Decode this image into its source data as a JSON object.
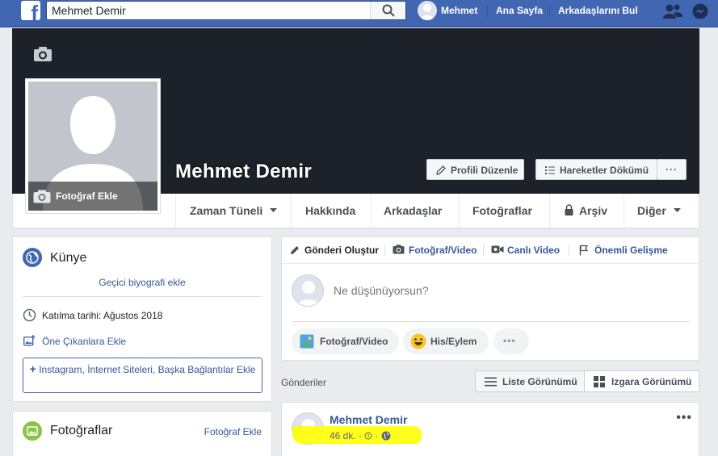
{
  "topbar": {
    "search_value": "Mehmet Demir",
    "user_name": "Mehmet",
    "home_label": "Ana Sayfa",
    "find_friends_label": "Arkadaşlarını Bul",
    "logo_glyph": "f",
    "colors": {
      "bar": "#4267b2",
      "accent": "#365899"
    }
  },
  "cover": {
    "name": "Mehmet Demir",
    "add_photo_label": "Fotoğraf Ekle",
    "edit_profile_label": "Profili Düzenle",
    "activity_log_label": "Hareketler Dökümü",
    "more_glyph": "···"
  },
  "tabs": [
    {
      "label": "Zaman Tüneli"
    },
    {
      "label": "Hakkında"
    },
    {
      "label": "Arkadaşlar"
    },
    {
      "label": "Fotoğraflar"
    },
    {
      "label": "Arşiv"
    },
    {
      "label": "Diğer"
    }
  ],
  "intro": {
    "title": "Künye",
    "temp_bio_link": "Geçici biyografi ekle",
    "join_date": "Katılma tarihi: Ağustos 2018",
    "featured_link": "Öne Çıkanlara Ekle",
    "add_links_label": "Instagram, İnternet Siteleri, Başka Bağlantılar Ekle"
  },
  "photos": {
    "title": "Fotoğraflar",
    "add_link": "Fotoğraf Ekle"
  },
  "composer": {
    "tabs": [
      "Gönderi Oluştur",
      "Fotoğraf/Video",
      "Canlı Video",
      "Önemli Gelişme"
    ],
    "placeholder": "Ne düşünüyorsun?",
    "actions": [
      "Fotoğraf/Video",
      "His/Eylem",
      "•••"
    ]
  },
  "posts": {
    "section_label": "Gönderiler",
    "list_view_label": "Liste Görünümü",
    "grid_view_label": "Izgara Görünümü",
    "first_post": {
      "author": "Mehmet Demir",
      "time": "46 dk.",
      "menu_glyph": "•••"
    }
  }
}
